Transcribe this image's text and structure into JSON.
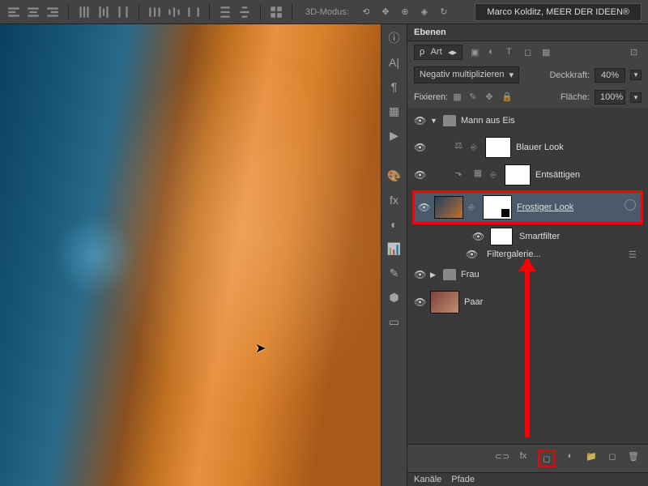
{
  "toolbar": {
    "mode_label": "3D-Modus:",
    "brand": "Marco Kolditz, MEER DER IDEEN®"
  },
  "panel": {
    "title": "Ebenen",
    "filter_label": "Art",
    "blend_mode": "Negativ multiplizieren",
    "opacity_label": "Deckkraft:",
    "opacity_value": "40%",
    "lock_label": "Fixieren:",
    "fill_label": "Fläche:",
    "fill_value": "100%"
  },
  "layers": {
    "group": "Mann aus Eis",
    "l1": "Blauer Look",
    "l2": "Entsättigen",
    "l3": "Frostiger Look",
    "smartfilter": "Smartfilter",
    "filtergalerie": "Filtergalerie...",
    "frau": "Frau",
    "paar": "Paar"
  },
  "tabs": {
    "kanale": "Kanäle",
    "pfade": "Pfade"
  }
}
